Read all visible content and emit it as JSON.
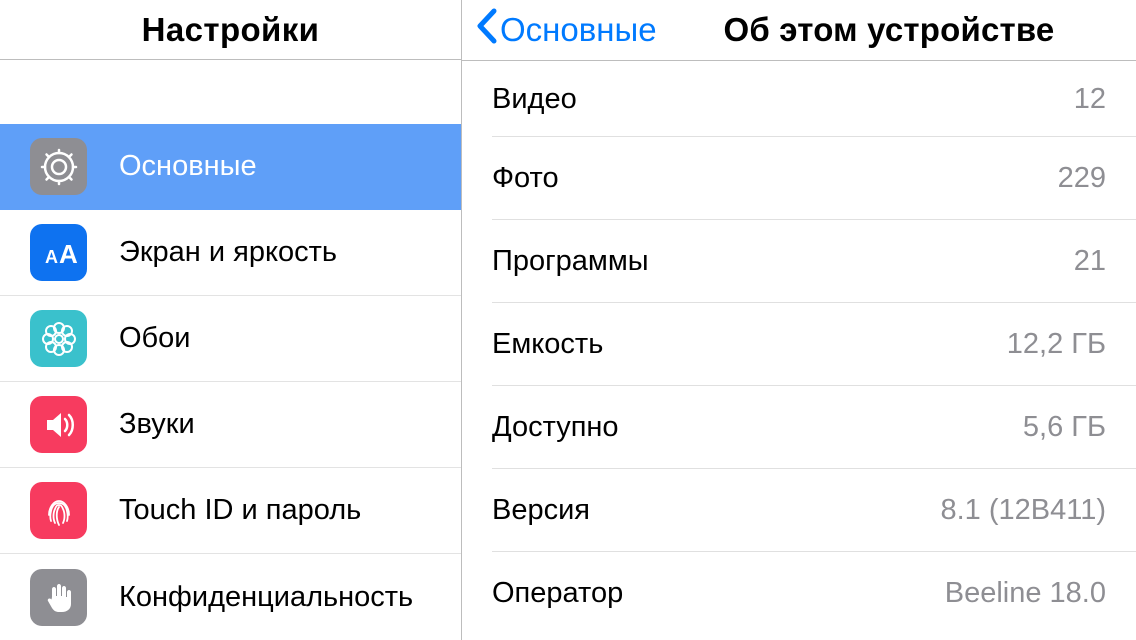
{
  "sidebar": {
    "title": "Настройки",
    "items": [
      {
        "label": "Основные",
        "selected": true
      },
      {
        "label": "Экран и яркость"
      },
      {
        "label": "Обои"
      },
      {
        "label": "Звуки"
      },
      {
        "label": "Touch ID и пароль"
      },
      {
        "label": "Конфиденциальность"
      }
    ]
  },
  "detail": {
    "back_label": "Основные",
    "title": "Об этом устройстве",
    "rows": [
      {
        "label": "Видео",
        "value": "12"
      },
      {
        "label": "Фото",
        "value": "229"
      },
      {
        "label": "Программы",
        "value": "21"
      },
      {
        "label": "Емкость",
        "value": "12,2 ГБ"
      },
      {
        "label": "Доступно",
        "value": "5,6 ГБ"
      },
      {
        "label": "Версия",
        "value": "8.1 (12B411)"
      },
      {
        "label": "Оператор",
        "value": "Beeline 18.0"
      }
    ]
  }
}
